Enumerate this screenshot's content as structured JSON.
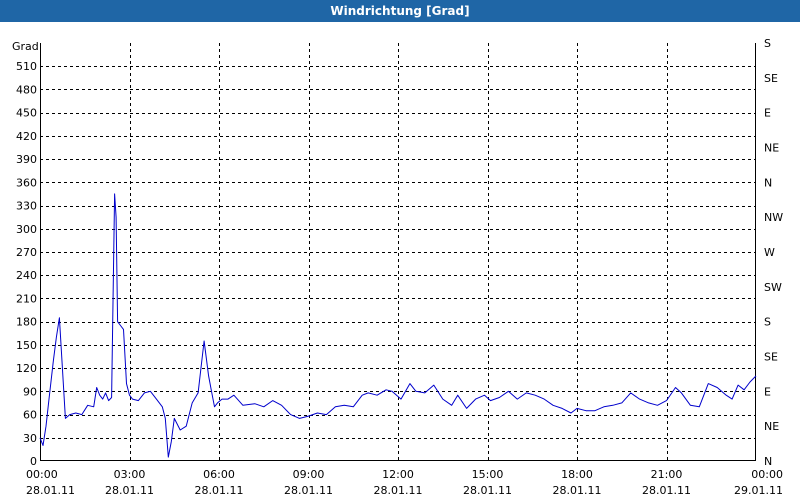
{
  "window": {
    "title": "Windrichtung [Grad]"
  },
  "chart_data": {
    "type": "line",
    "title": "Windrichtung [Grad]",
    "ylabel": "Grad",
    "xlabel": "",
    "ylim": [
      0,
      540
    ],
    "xlim": [
      "28.01.11 00:00",
      "29.01.11 00:00"
    ],
    "yticks": [
      0,
      30,
      60,
      90,
      120,
      150,
      180,
      210,
      240,
      270,
      300,
      330,
      360,
      390,
      420,
      450,
      480,
      510
    ],
    "xticks": [
      {
        "time": "00:00",
        "date": "28.01.11",
        "hour": 0
      },
      {
        "time": "03:00",
        "date": "28.01.11",
        "hour": 3
      },
      {
        "time": "06:00",
        "date": "28.01.11",
        "hour": 6
      },
      {
        "time": "09:00",
        "date": "28.01.11",
        "hour": 9
      },
      {
        "time": "12:00",
        "date": "28.01.11",
        "hour": 12
      },
      {
        "time": "15:00",
        "date": "28.01.11",
        "hour": 15
      },
      {
        "time": "18:00",
        "date": "28.01.11",
        "hour": 18
      },
      {
        "time": "21:00",
        "date": "28.01.11",
        "hour": 21
      },
      {
        "time": "00:00",
        "date": "29.01.11",
        "hour": 24
      }
    ],
    "right_axis": [
      {
        "value": 0,
        "label": "N"
      },
      {
        "value": 45,
        "label": "NE"
      },
      {
        "value": 90,
        "label": "E"
      },
      {
        "value": 135,
        "label": "SE"
      },
      {
        "value": 180,
        "label": "S"
      },
      {
        "value": 225,
        "label": "SW"
      },
      {
        "value": 270,
        "label": "W"
      },
      {
        "value": 315,
        "label": "NW"
      },
      {
        "value": 360,
        "label": "N"
      },
      {
        "value": 405,
        "label": "NE"
      },
      {
        "value": 450,
        "label": "E"
      },
      {
        "value": 495,
        "label": "SE"
      },
      {
        "value": 540,
        "label": "S"
      }
    ],
    "grid": true,
    "line_color": "#0000cc",
    "series": [
      {
        "x": [
          0,
          0.1,
          0.2,
          0.3,
          0.45,
          0.55,
          0.65,
          0.75,
          0.85,
          1.0,
          1.2,
          1.4,
          1.6,
          1.8,
          1.9,
          2.0,
          2.1,
          2.2,
          2.3,
          2.4,
          2.5,
          2.55,
          2.6,
          2.7,
          2.8,
          2.9,
          3.0,
          3.1,
          3.3,
          3.5,
          3.7,
          3.9,
          4.1,
          4.2,
          4.3,
          4.4,
          4.5,
          4.7,
          4.9,
          5.1,
          5.3,
          5.5,
          5.65,
          5.75,
          5.85,
          5.95,
          6.1,
          6.3,
          6.5,
          6.8,
          7.0,
          7.2,
          7.5,
          7.8,
          8.1,
          8.4,
          8.7,
          9.0,
          9.3,
          9.6,
          9.9,
          10.2,
          10.5,
          10.8,
          11.0,
          11.3,
          11.6,
          11.8,
          12.1,
          12.4,
          12.6,
          12.9,
          13.2,
          13.5,
          13.8,
          14.0,
          14.3,
          14.6,
          14.9,
          15.1,
          15.4,
          15.7,
          16.0,
          16.3,
          16.6,
          16.9,
          17.2,
          17.5,
          17.8,
          18.0,
          18.3,
          18.6,
          18.9,
          19.2,
          19.5,
          19.8,
          20.1,
          20.4,
          20.7,
          21.0,
          21.3,
          21.5,
          21.8,
          22.1,
          22.4,
          22.7,
          23.0,
          23.2,
          23.4,
          23.6,
          23.8,
          24.0
        ],
        "values": [
          30,
          20,
          45,
          80,
          130,
          160,
          185,
          120,
          55,
          60,
          62,
          60,
          72,
          70,
          95,
          85,
          80,
          88,
          78,
          82,
          345,
          315,
          180,
          175,
          170,
          100,
          85,
          80,
          78,
          88,
          90,
          80,
          70,
          55,
          5,
          25,
          55,
          40,
          45,
          75,
          88,
          155,
          110,
          90,
          70,
          75,
          80,
          80,
          85,
          72,
          73,
          74,
          70,
          78,
          72,
          60,
          55,
          58,
          62,
          60,
          70,
          72,
          70,
          85,
          88,
          85,
          92,
          90,
          80,
          100,
          90,
          88,
          98,
          80,
          72,
          85,
          68,
          80,
          85,
          78,
          82,
          90,
          80,
          88,
          85,
          80,
          72,
          68,
          62,
          68,
          65,
          65,
          70,
          72,
          75,
          88,
          80,
          75,
          72,
          78,
          95,
          88,
          72,
          70,
          100,
          95,
          85,
          80,
          98,
          92,
          102,
          110
        ]
      }
    ]
  }
}
